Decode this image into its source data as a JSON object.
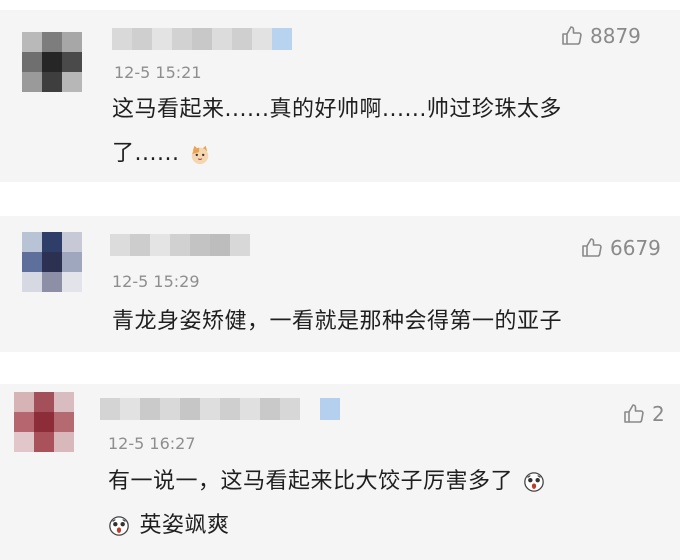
{
  "comments": [
    {
      "likes": "8879",
      "time": "12-5 15:21",
      "line1": "这马看起来......真的好帅啊......帅过珍珠太多",
      "line2": "了......",
      "emoji": "cat-face"
    },
    {
      "likes": "6679",
      "time": "12-5 15:29",
      "line1": "青龙身姿矫健，一看就是那种会得第一的亚子"
    },
    {
      "likes": "2",
      "time": "12-5 16:27",
      "line1": "有一说一，这马看起来比大饺子厉害多了",
      "line2": "英姿飒爽",
      "emoji": "scared-face"
    }
  ],
  "colors": {
    "card_bg": "#f5f5f5",
    "meta_gray": "#8e8e8e",
    "text": "#1f1f1f"
  }
}
